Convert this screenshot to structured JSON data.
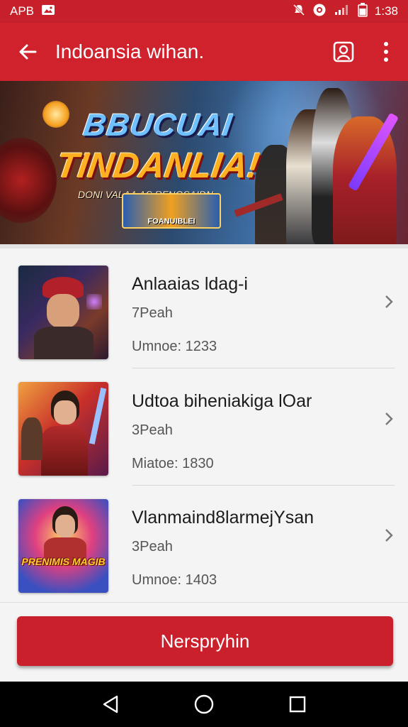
{
  "status_bar": {
    "left_text": "APB",
    "time": "1:38",
    "icons": [
      "image-icon",
      "notifications-off-icon",
      "vpn-icon",
      "signal-icon",
      "battery-icon"
    ]
  },
  "app_bar": {
    "title": "Indoansia wihan.",
    "icons": [
      "back-arrow-icon",
      "profile-badge-icon",
      "more-vert-icon"
    ]
  },
  "banner": {
    "title_line_1": "BBUCUAI",
    "title_line_2": "TINDANLIA!",
    "subtitle": "DONI VALAA AS RFNGSAIDN",
    "chip_text": "FOANUIBLEI"
  },
  "games": [
    {
      "name": "Anlaaias ldag-i",
      "size": "7Peah",
      "meta": "Umnoe: 1233"
    },
    {
      "name": "Udtoa biheniakiga lOar",
      "size": "3Peah",
      "meta": "Miatoe: 1830"
    },
    {
      "name": "Vlanmaind8larmejYsan",
      "size": "3Peah",
      "meta": "Umnoe: 1403",
      "thumb_text": "PRENIMIS MAGIB"
    }
  ],
  "cta_label": "Nerspryhin",
  "colors": {
    "primary": "#d0222c",
    "status_bar": "#c8202a",
    "cta": "#c9202b"
  }
}
